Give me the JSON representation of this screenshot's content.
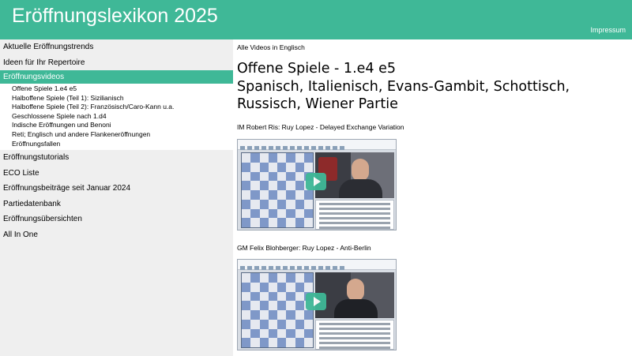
{
  "header": {
    "title": "Eröffnungslexikon 2025",
    "impressum": "Impressum",
    "color": "#3fb897"
  },
  "sidebar": {
    "items_top": [
      {
        "label": "Aktuelle Eröffnungstrends"
      },
      {
        "label": "Ideen für Ihr Repertoire"
      }
    ],
    "active_item": {
      "label": "Eröffnungsvideos"
    },
    "subitems": [
      {
        "label": "Offene Spiele 1.e4 e5"
      },
      {
        "label": "Halboffene Spiele (Teil 1): Sizilianisch"
      },
      {
        "label": "Halboffene Spiele (Teil 2): Französisch/Caro-Kann u.a."
      },
      {
        "label": "Geschlossene Spiele nach 1.d4"
      },
      {
        "label": "Indische Eröffnungen und Benoni"
      },
      {
        "label": "Reti; Englisch und andere Flankeneröffnungen"
      },
      {
        "label": "Eröffnungsfallen"
      }
    ],
    "items_bottom": [
      {
        "label": "Eröffnungstutorials"
      },
      {
        "label": "ECO Liste"
      },
      {
        "label": "Eröffnungsbeiträge seit Januar 2024"
      },
      {
        "label": "Partiedatenbank"
      },
      {
        "label": "Eröffnungsübersichten"
      },
      {
        "label": "All In One"
      }
    ]
  },
  "main": {
    "note": "Alle Videos in Englisch",
    "heading": "Offene Spiele - 1.e4 e5",
    "subheading": "Spanisch, Italienisch, Evans-Gambit, Schottisch, Russisch, Wiener Partie",
    "videos": [
      {
        "label": "IM Robert Ris: Ruy Lopez - Delayed Exchange Variation",
        "icon": "play-icon"
      },
      {
        "label": "GM Felix Blohberger: Ruy Lopez - Anti-Berlin",
        "icon": "play-icon"
      }
    ]
  }
}
